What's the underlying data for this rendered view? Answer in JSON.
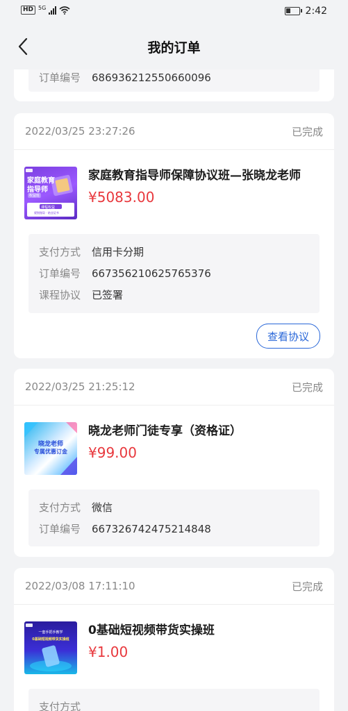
{
  "status_bar": {
    "network": "5G",
    "hd": "HD",
    "time": "2:42",
    "battery_level": 0.35
  },
  "nav": {
    "title": "我的订单"
  },
  "orders": [
    {
      "info": [
        {
          "label": "订单编号",
          "value": "686936212550660096"
        }
      ]
    },
    {
      "date": "2022/03/25 23:27:26",
      "status": "已完成",
      "thumb": {
        "t1": "家庭教育",
        "t2": "指导师",
        "tag": "权益班",
        "badge": "课程权益",
        "sub": "规划指导 · 结业证书"
      },
      "name": "家庭教育指导师保障协议班—张晓龙老师",
      "price": "¥5083.00",
      "info": [
        {
          "label": "支付方式",
          "value": "信用卡分期"
        },
        {
          "label": "订单编号",
          "value": "667356210625765376"
        },
        {
          "label": "课程协议",
          "value": "已签署"
        }
      ],
      "button": "查看协议"
    },
    {
      "date": "2022/03/25 21:25:12",
      "status": "已完成",
      "thumb": {
        "t1": "晓龙老师",
        "t2": "专属优惠订金"
      },
      "name": "晓龙老师门徒专享（资格证）",
      "price": "¥99.00",
      "info": [
        {
          "label": "支付方式",
          "value": "微信"
        },
        {
          "label": "订单编号",
          "value": "667326742475214848"
        }
      ]
    },
    {
      "date": "2022/03/08 17:11:10",
      "status": "已完成",
      "thumb": {
        "t1": "一套手把手教学",
        "t2": "0基础短视频带货实操班"
      },
      "name": "0基础短视频带货实操班",
      "price": "¥1.00",
      "info": [
        {
          "label": "支付方式",
          "value": ""
        }
      ]
    }
  ],
  "colors": {
    "price": "#e8383d",
    "accent": "#2866d8",
    "background": "#f2f3f5"
  }
}
